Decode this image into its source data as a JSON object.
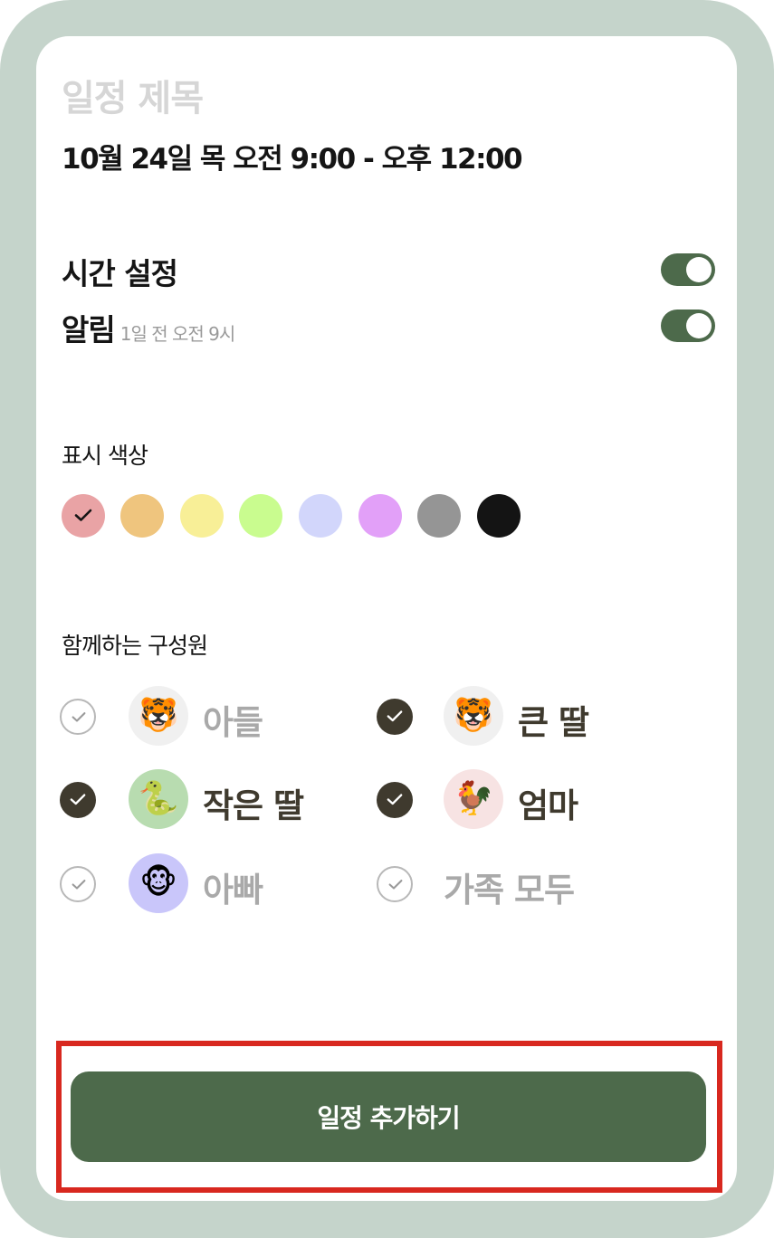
{
  "header": {
    "title_placeholder": "일정 제목",
    "datetime": "10월 24일 목 오전 9:00 - 오후 12:00"
  },
  "settings": {
    "time_setting": {
      "label": "시간 설정",
      "enabled": true
    },
    "alarm": {
      "label": "알림",
      "detail": "1일 전 오전 9시",
      "enabled": true
    }
  },
  "color_section": {
    "label": "표시 색상",
    "swatches": [
      "#e9a3a5",
      "#efc57e",
      "#f8ef97",
      "#c9fc8f",
      "#d2d6fb",
      "#e2a0f8",
      "#959595",
      "#141414"
    ],
    "selected_index": 0
  },
  "members_section": {
    "label": "함께하는 구성원",
    "members": [
      {
        "name": "아들",
        "checked": false,
        "avatar_icon": "tiger-icon",
        "avatar_glyph": "🐯",
        "avatar_bg": "#f0f0f0"
      },
      {
        "name": "큰 딸",
        "checked": true,
        "avatar_icon": "tiger-icon",
        "avatar_glyph": "🐯",
        "avatar_bg": "#f0f0f0"
      },
      {
        "name": "작은 딸",
        "checked": true,
        "avatar_icon": "snake-icon",
        "avatar_glyph": "🐍",
        "avatar_bg": "#b8dcb0"
      },
      {
        "name": "엄마",
        "checked": true,
        "avatar_icon": "rooster-icon",
        "avatar_glyph": "🐓",
        "avatar_bg": "#f7e3e3"
      },
      {
        "name": "아빠",
        "checked": false,
        "avatar_icon": "monkey-icon",
        "avatar_glyph": "🐵",
        "avatar_bg": "#c9c6fa"
      },
      {
        "name": "가족 모두",
        "checked": false
      }
    ]
  },
  "actions": {
    "add_button_label": "일정 추가하기",
    "button_color": "#4d6a4b",
    "highlight_color": "#d8281f"
  }
}
